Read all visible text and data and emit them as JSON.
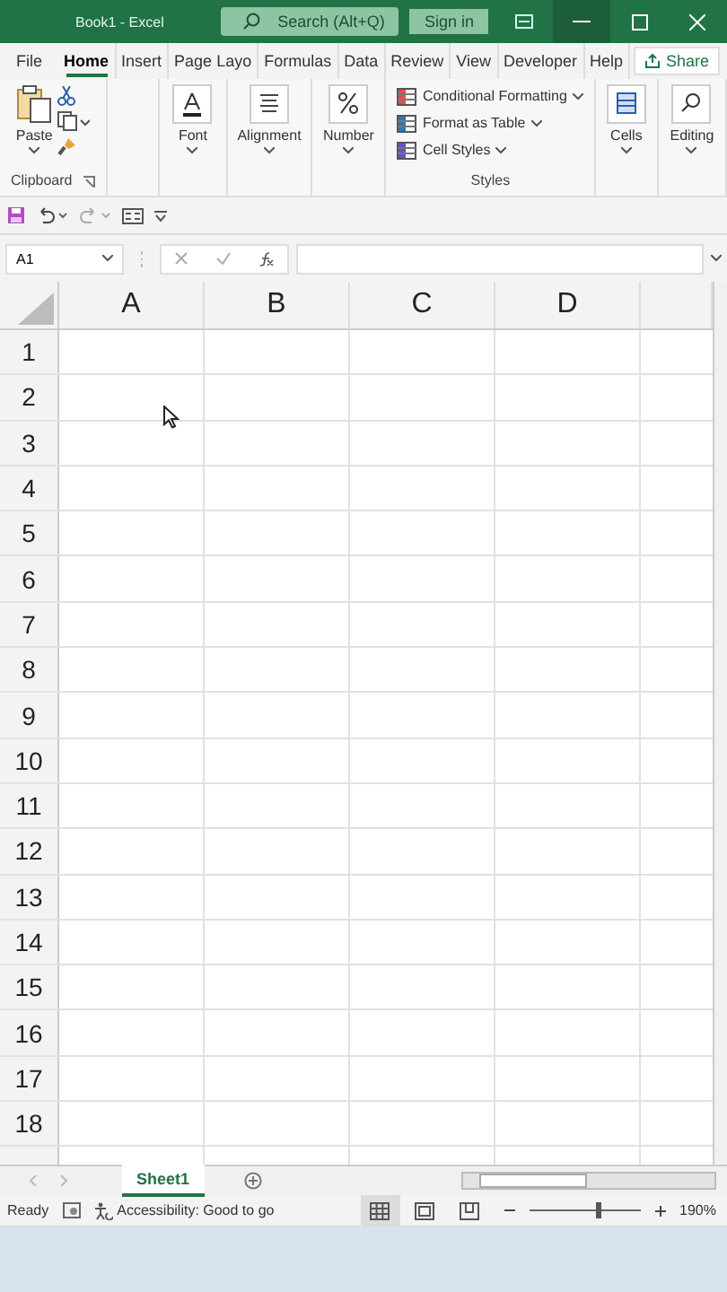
{
  "window": {
    "title": "Book1 - Excel",
    "search": {
      "placeholder": "Search (Alt+Q)"
    },
    "sign_in": "Sign in"
  },
  "menu_tabs": [
    {
      "label": "File",
      "selected": false
    },
    {
      "label": "Home",
      "selected": true
    },
    {
      "label": "Insert",
      "selected": false
    },
    {
      "label": "Page Layo",
      "selected": false
    },
    {
      "label": "Formulas",
      "selected": false
    },
    {
      "label": "Data",
      "selected": false
    },
    {
      "label": "Review",
      "selected": false
    },
    {
      "label": "View",
      "selected": false
    },
    {
      "label": "Developer",
      "selected": false
    },
    {
      "label": "Help",
      "selected": false
    }
  ],
  "share": "Share",
  "ribbon": {
    "paste": "Paste",
    "clipboard": "Clipboard",
    "font": "Font",
    "alignment": "Alignment",
    "number": "Number",
    "styles_items": [
      "Conditional Formatting",
      "Format as Table",
      "Cell Styles"
    ],
    "styles": "Styles",
    "cells": "Cells",
    "editing": "Editing"
  },
  "name_box": "A1",
  "columns": [
    "A",
    "B",
    "C",
    "D"
  ],
  "rows": [
    "1",
    "2",
    "3",
    "4",
    "5",
    "6",
    "7",
    "8",
    "9",
    "10",
    "11",
    "12",
    "13",
    "14",
    "15",
    "16",
    "17",
    "18"
  ],
  "sheet_tabs": [
    {
      "label": "Sheet1",
      "selected": true
    }
  ],
  "status_bar": {
    "ready": "Ready",
    "accessibility": "Accessibility: Good to go",
    "views": [
      {
        "kind": "normal",
        "selected": true
      },
      {
        "kind": "page_layout",
        "selected": false
      },
      {
        "kind": "page_break",
        "selected": false
      }
    ],
    "zoom": {
      "level": 0.62,
      "reading": "190%"
    }
  }
}
